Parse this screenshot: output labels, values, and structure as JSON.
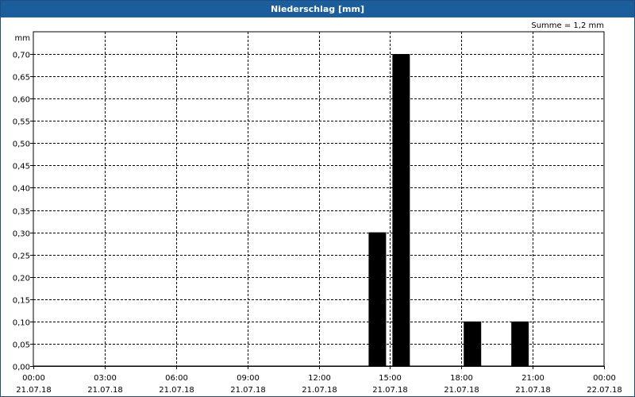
{
  "window": {
    "title": "Niederschlag [mm]"
  },
  "chart_data": {
    "type": "bar",
    "title": "Niederschlag [mm]",
    "ylabel": "mm",
    "xlabel": "",
    "annotation": "Summe = 1,2 mm",
    "ylim": [
      0,
      0.75
    ],
    "yticks": [
      "0,00",
      "0,05",
      "0,10",
      "0,15",
      "0,20",
      "0,25",
      "0,30",
      "0,35",
      "0,40",
      "0,45",
      "0,50",
      "0,55",
      "0,60",
      "0,65",
      "0,70"
    ],
    "ytick_values": [
      0,
      0.05,
      0.1,
      0.15,
      0.2,
      0.25,
      0.3,
      0.35,
      0.4,
      0.45,
      0.5,
      0.55,
      0.6,
      0.65,
      0.7
    ],
    "xlim_hours": [
      0,
      24
    ],
    "xticks": [
      {
        "time": "00:00",
        "date": "21.07.18"
      },
      {
        "time": "03:00",
        "date": "21.07.18"
      },
      {
        "time": "06:00",
        "date": "21.07.18"
      },
      {
        "time": "09:00",
        "date": "21.07.18"
      },
      {
        "time": "12:00",
        "date": "21.07.18"
      },
      {
        "time": "15:00",
        "date": "21.07.18"
      },
      {
        "time": "18:00",
        "date": "21.07.18"
      },
      {
        "time": "21:00",
        "date": "21.07.18"
      },
      {
        "time": "00:00",
        "date": "22.07.18"
      }
    ],
    "grid": true,
    "bars": [
      {
        "time": "14:00",
        "value": 0.3
      },
      {
        "time": "15:00",
        "value": 0.7
      },
      {
        "time": "18:00",
        "value": 0.1
      },
      {
        "time": "20:00",
        "value": 0.1
      }
    ],
    "bar_color": "#000000",
    "grid_color": "#000000",
    "titlebar_color": "#1c5e9c"
  }
}
